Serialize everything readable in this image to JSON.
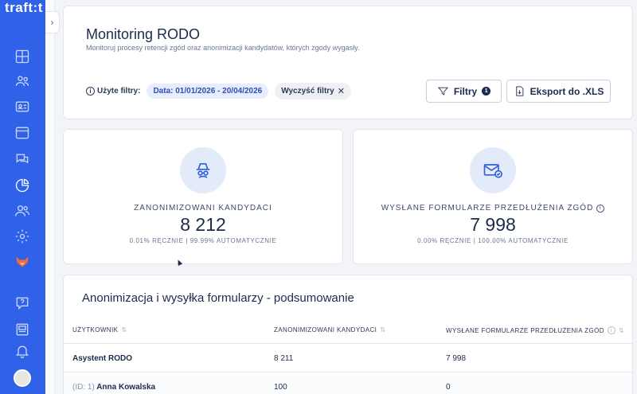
{
  "app": {
    "logo_text": "traft:t"
  },
  "sidebar": {
    "items": [
      {
        "name": "dashboard-icon"
      },
      {
        "name": "candidates-icon"
      },
      {
        "name": "id-card-icon"
      },
      {
        "name": "calendar-window-icon"
      },
      {
        "name": "chat-icon"
      },
      {
        "name": "reports-pie-icon",
        "active": true
      },
      {
        "name": "users-icon"
      },
      {
        "name": "settings-gear-icon"
      },
      {
        "name": "fox-icon"
      },
      {
        "name": "help-icon"
      },
      {
        "name": "news-icon"
      },
      {
        "name": "bell-icon"
      }
    ]
  },
  "header": {
    "title": "Monitoring RODO",
    "subtitle": "Monitoruj procesy retencji zgód oraz anonimizacji kandydatów, których zgody wygasły.",
    "filters_label": "Użyte filtry:",
    "date_chip": "Data: 01/01/2026 - 20/04/2026",
    "clear_chip": "Wyczyść filtry",
    "filters_button": "Filtry",
    "filters_count": "1",
    "export_button": "Eksport do .XLS"
  },
  "stats": {
    "anonymized": {
      "label": "ZANONIMIZOWANI KANDYDACI",
      "value": "8 212",
      "sub": "0.01% RĘCZNIE | 99.99% AUTOMATYCZNIE"
    },
    "forms_sent": {
      "label": "WYSŁANE FORMULARZE PRZEDŁUŻENIA ZGÓD",
      "value": "7 998",
      "sub": "0.00% RĘCZNIE | 100.00% AUTOMATYCZNIE"
    }
  },
  "summary": {
    "title": "Anonimizacja i wysyłka formularzy - podsumowanie",
    "columns": [
      "UŻYTKOWNIK",
      "ZANONIMIZOWANI KANDYDACI",
      "WYSŁANE FORMULARZE PRZEDŁUŻENIA ZGÓD"
    ],
    "rows": [
      {
        "user": "Asystent RODO",
        "id_prefix": "",
        "anonymized": "8 211",
        "forms": "7 998"
      },
      {
        "user": "Anna Kowalska",
        "id_prefix": "(ID: 1)",
        "anonymized": "100",
        "forms": "0"
      }
    ]
  },
  "colors": {
    "sidebar": "#2f62e8",
    "accent_chip": "#e7edfc",
    "icon_circle": "#e3ebfb"
  }
}
